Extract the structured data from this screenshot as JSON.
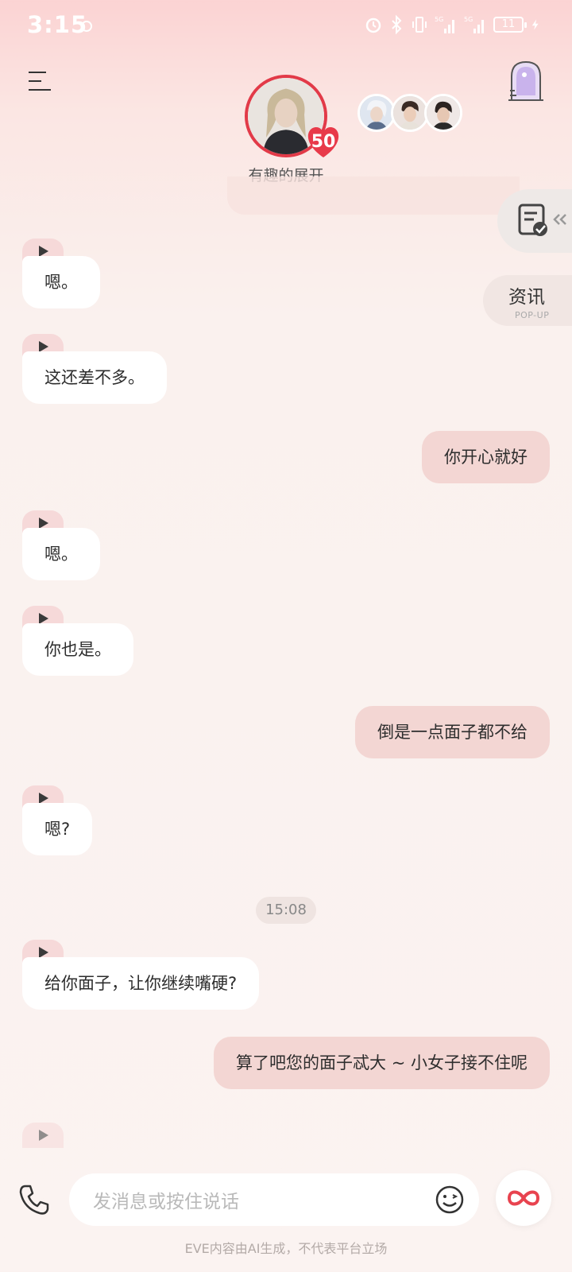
{
  "status_bar": {
    "time": "3:15",
    "battery": "11"
  },
  "header": {
    "character_name": "有趣的展开",
    "level": "50",
    "icons": [
      "menu-icon",
      "window-icon"
    ]
  },
  "side": {
    "news_label": "资讯",
    "news_sub": "POP-UP"
  },
  "messages": [
    {
      "from": "ai",
      "text": "嗯。"
    },
    {
      "from": "ai",
      "text": "这还差不多。"
    },
    {
      "from": "me",
      "text": "你开心就好"
    },
    {
      "from": "ai",
      "text": "嗯。"
    },
    {
      "from": "ai",
      "text": "你也是。"
    },
    {
      "from": "me",
      "text": "倒是一点面子都不给"
    },
    {
      "from": "ai",
      "text": "嗯?"
    },
    {
      "from": "time",
      "text": "15:08"
    },
    {
      "from": "ai",
      "text": "给你面子，让你继续嘴硬?"
    },
    {
      "from": "me",
      "text": "算了吧您的面子忒大 ~ 小女子接不住呢"
    }
  ],
  "input": {
    "placeholder": "发消息或按住说话"
  },
  "footer": {
    "disclaimer": "EVE内容由AI生成，不代表平台立场"
  },
  "colors": {
    "accent": "#e23a48",
    "my_bubble": "#f3d6d3",
    "ai_bubble": "#ffffff"
  }
}
